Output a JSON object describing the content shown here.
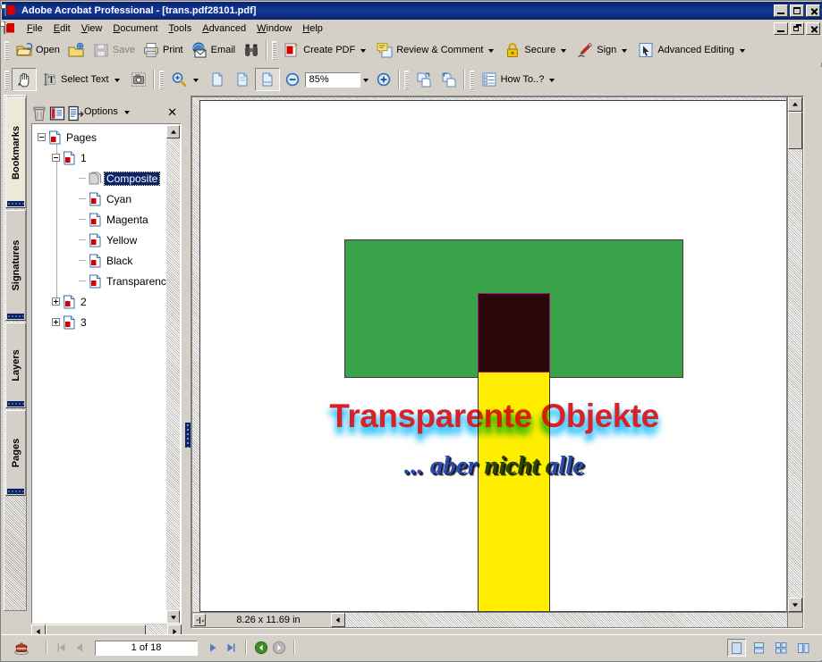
{
  "window": {
    "title": "Adobe Acrobat Professional - [trans.pdf28101.pdf]",
    "app_icon": "acrobat-icon",
    "controls": {
      "minimize": "_",
      "maximize": "□",
      "restore": "❐",
      "close": "✕"
    }
  },
  "menubar": {
    "items": [
      {
        "label": "File",
        "mnemonic": "F"
      },
      {
        "label": "Edit",
        "mnemonic": "E"
      },
      {
        "label": "View",
        "mnemonic": "V"
      },
      {
        "label": "Document",
        "mnemonic": "D"
      },
      {
        "label": "Tools",
        "mnemonic": "T"
      },
      {
        "label": "Advanced",
        "mnemonic": "A"
      },
      {
        "label": "Window",
        "mnemonic": "W"
      },
      {
        "label": "Help",
        "mnemonic": "H"
      }
    ]
  },
  "toolbar_file": {
    "buttons": [
      {
        "label": "Open",
        "icon": "open-folder-icon",
        "enabled": true,
        "dropdown": false
      },
      {
        "label": "",
        "icon": "organizer-icon",
        "enabled": true,
        "dropdown": false
      },
      {
        "label": "Save",
        "icon": "floppy-disk-icon",
        "enabled": false,
        "dropdown": false
      },
      {
        "label": "Print",
        "icon": "printer-icon",
        "enabled": true,
        "dropdown": false
      },
      {
        "label": "Email",
        "icon": "email-icon",
        "enabled": true,
        "dropdown": false
      },
      {
        "label": "",
        "icon": "search-binocular-icon",
        "enabled": true,
        "dropdown": false
      }
    ]
  },
  "toolbar_tasks": {
    "buttons": [
      {
        "label": "Create PDF",
        "icon": "create-pdf-icon",
        "dropdown": true
      },
      {
        "label": "Review & Comment",
        "icon": "review-comment-icon",
        "dropdown": true
      },
      {
        "label": "Secure",
        "icon": "padlock-icon",
        "dropdown": true
      },
      {
        "label": "Sign",
        "icon": "pen-sign-icon",
        "dropdown": true
      },
      {
        "label": "Advanced Editing",
        "icon": "advanced-editing-icon",
        "dropdown": true
      }
    ]
  },
  "toolbar_basic": {
    "hand_tool": {
      "icon": "hand-icon",
      "selected": true
    },
    "select_text": {
      "label": "Select Text",
      "icon": "text-select-icon",
      "dropdown": true
    },
    "snapshot": {
      "icon": "camera-snapshot-icon"
    }
  },
  "toolbar_zoom": {
    "zoom_tool": {
      "icon": "magnifier-plus-icon",
      "dropdown": true
    },
    "actual_size": {
      "icon": "page-actual-size-icon",
      "selected": false
    },
    "fit_page": {
      "icon": "page-fit-icon",
      "selected": false
    },
    "fit_width": {
      "icon": "page-fit-width-icon",
      "selected": true
    },
    "zoom_out": {
      "icon": "zoom-out-circle-icon"
    },
    "zoom_value": "85%",
    "zoom_in": {
      "icon": "zoom-in-circle-icon"
    }
  },
  "toolbar_rotate": {
    "rotate_ccw": {
      "icon": "rotate-counterclockwise-icon"
    },
    "rotate_cw": {
      "icon": "rotate-clockwise-icon"
    }
  },
  "toolbar_help": {
    "how_to": {
      "label": "How To..?",
      "icon": "howto-list-icon",
      "dropdown": true
    }
  },
  "nav_tabs": {
    "items": [
      {
        "label": "Bookmarks",
        "active": true
      },
      {
        "label": "Signatures",
        "active": false
      },
      {
        "label": "Layers",
        "active": false
      },
      {
        "label": "Pages",
        "active": false
      }
    ]
  },
  "nav_panel": {
    "header": {
      "delete_icon": "trash-icon",
      "new_bookmark_icon": "new-bookmark-icon",
      "expand_icon": "expand-current-bookmark-icon",
      "options_label": "Options",
      "close_label": "✕"
    },
    "tree": [
      {
        "label": "Pages",
        "depth": 0,
        "toggle": "minus",
        "icon": "pdf-page-icon",
        "selected": false
      },
      {
        "label": "1",
        "depth": 1,
        "toggle": "minus",
        "icon": "pdf-page-icon",
        "selected": false
      },
      {
        "label": "Composite",
        "depth": 2,
        "toggle": "none",
        "icon": "gray-page-icon",
        "selected": true
      },
      {
        "label": "Cyan",
        "depth": 2,
        "toggle": "none",
        "icon": "pdf-page-icon",
        "selected": false
      },
      {
        "label": "Magenta",
        "depth": 2,
        "toggle": "none",
        "icon": "pdf-page-icon",
        "selected": false
      },
      {
        "label": "Yellow",
        "depth": 2,
        "toggle": "none",
        "icon": "pdf-page-icon",
        "selected": false
      },
      {
        "label": "Black",
        "depth": 2,
        "toggle": "none",
        "icon": "pdf-page-icon",
        "selected": false
      },
      {
        "label": "Transparency",
        "depth": 2,
        "toggle": "none",
        "icon": "pdf-page-icon",
        "selected": false
      },
      {
        "label": "2",
        "depth": 1,
        "toggle": "plus",
        "icon": "pdf-page-icon",
        "selected": false
      },
      {
        "label": "3",
        "depth": 1,
        "toggle": "plus",
        "icon": "pdf-page-icon",
        "selected": false
      }
    ]
  },
  "document": {
    "page_size_label": "8.26 x 11.69 in",
    "content": {
      "title_text": "Transparente Objekte",
      "subtitle_text": "... aber nicht alle",
      "shapes": [
        {
          "name": "green-rectangle",
          "color": "#3aa349",
          "border": "#3b3b3b"
        },
        {
          "name": "yellow-bar",
          "color": "#ffee00",
          "border": "#3b3b3b"
        },
        {
          "name": "dark-overlap-box",
          "color": "#2b0608",
          "border": "#a01a7a"
        }
      ],
      "title_color": "#d8222a",
      "title_glow_color": "#00beff",
      "subtitle_color": "#2b4ba8",
      "subtitle_shadow_color": "#15183a"
    }
  },
  "statusbar": {
    "app_badge_icon": "acrobat-tray-icon",
    "first_page_icon": "first-page-icon",
    "prev_page_icon": "previous-page-icon",
    "page_indicator": "1 of 18",
    "next_page_icon": "next-page-icon",
    "last_page_icon": "last-page-icon",
    "prev_view_icon": "previous-view-icon",
    "next_view_icon": "next-view-icon",
    "view_modes": [
      {
        "name": "single-page-view",
        "selected": true
      },
      {
        "name": "continuous-view",
        "selected": false
      },
      {
        "name": "facing-view",
        "selected": false
      },
      {
        "name": "continuous-facing-view",
        "selected": false
      }
    ]
  }
}
